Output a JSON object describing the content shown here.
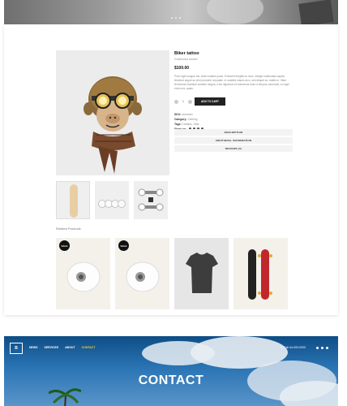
{
  "product": {
    "title": "Biker tattoo",
    "category_line": "Cushioned moorel",
    "price": "$100.00",
    "description": "Proin eget congue est, vitae sodales quam. Praesent fringilla ex nunc. Integer malesuada sapien tincidunt augue ac enim posuere vulputate. In sodales mauris arcu, sed aliquet ac, mattis ut. Vitae fermentum tincidunt sodales magna, a leo dignissim id maecenas dolor a tempus commodo, eu eget erat nunc, quam.",
    "quantity": "1",
    "add_to_cart_label": "ADD TO CART",
    "sku_label": "SKU:",
    "sku_value": "Unknown",
    "category_label": "Category:",
    "category_value": "Clothing",
    "tags_label": "Tags:",
    "tags_value": "Creative, Gifts",
    "share_label": "Share on:"
  },
  "tabs": [
    "DESCRIPTION",
    "ADDITIONAL INFORMATION",
    "REVIEWS (0)"
  ],
  "related": {
    "title": "Related Products",
    "sale_label": "SALE"
  },
  "banner": {
    "logo": "B",
    "menu": [
      "NEWS",
      "SERVICES",
      "ABOUT",
      "CONTACT"
    ],
    "callus": "Call Us 000-0000",
    "title": "CONTACT"
  },
  "colors": {
    "accent": "#f4d03f",
    "sky": "#2a74b4",
    "dark_button": "#222222"
  },
  "icons": [
    "facebook-icon",
    "twitter-icon",
    "pinterest-icon",
    "instagram-icon",
    "phone-icon"
  ]
}
